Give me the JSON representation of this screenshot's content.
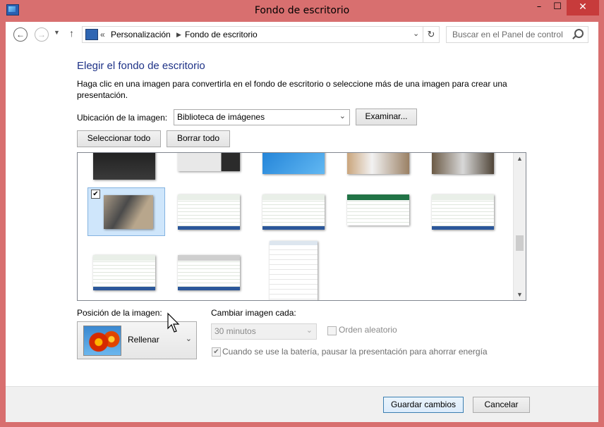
{
  "window": {
    "title": "Fondo de escritorio",
    "controls": {
      "minimize": "–",
      "maximize": "☐",
      "close": "✕"
    }
  },
  "address_bar": {
    "back_icon": "←",
    "forward_icon": "→",
    "up_icon": "↑",
    "crumb_separator": "«",
    "crumbs": [
      "Personalización",
      "Fondo de escritorio"
    ],
    "search_placeholder": "Buscar en el Panel de control"
  },
  "main": {
    "heading": "Elegir el fondo de escritorio",
    "description": "Haga clic en una imagen para convertirla en el fondo de escritorio o seleccione más de una imagen para crear una presentación.",
    "location_label": "Ubicación de la imagen:",
    "location_value": "Biblioteca de imágenes",
    "browse_button": "Examinar...",
    "select_all_button": "Seleccionar todo",
    "clear_all_button": "Borrar todo",
    "thumbnails": [
      {
        "kind": "dark-desktop",
        "selected": false
      },
      {
        "kind": "login-screen",
        "selected": false
      },
      {
        "kind": "start-screen",
        "selected": false
      },
      {
        "kind": "window-photo",
        "selected": false
      },
      {
        "kind": "laptop-photo",
        "selected": false
      },
      {
        "kind": "tablet-photo",
        "selected": true
      },
      {
        "kind": "spreadsheet",
        "selected": false
      },
      {
        "kind": "spreadsheet",
        "selected": false
      },
      {
        "kind": "spreadsheet-small",
        "selected": false
      },
      {
        "kind": "spreadsheet",
        "selected": false
      },
      {
        "kind": "spreadsheet",
        "selected": false
      },
      {
        "kind": "spreadsheet",
        "selected": false
      },
      {
        "kind": "dialog-tall",
        "selected": false
      }
    ]
  },
  "options": {
    "position_label": "Posición de la imagen:",
    "position_value": "Rellenar",
    "change_label": "Cambiar imagen cada:",
    "interval_value": "30 minutos",
    "shuffle_label": "Orden aleatorio",
    "shuffle_checked": false,
    "battery_label": "Cuando se use la batería, pausar la presentación para ahorrar energía",
    "battery_checked": true
  },
  "footer": {
    "save_button": "Guardar cambios",
    "cancel_button": "Cancelar"
  }
}
